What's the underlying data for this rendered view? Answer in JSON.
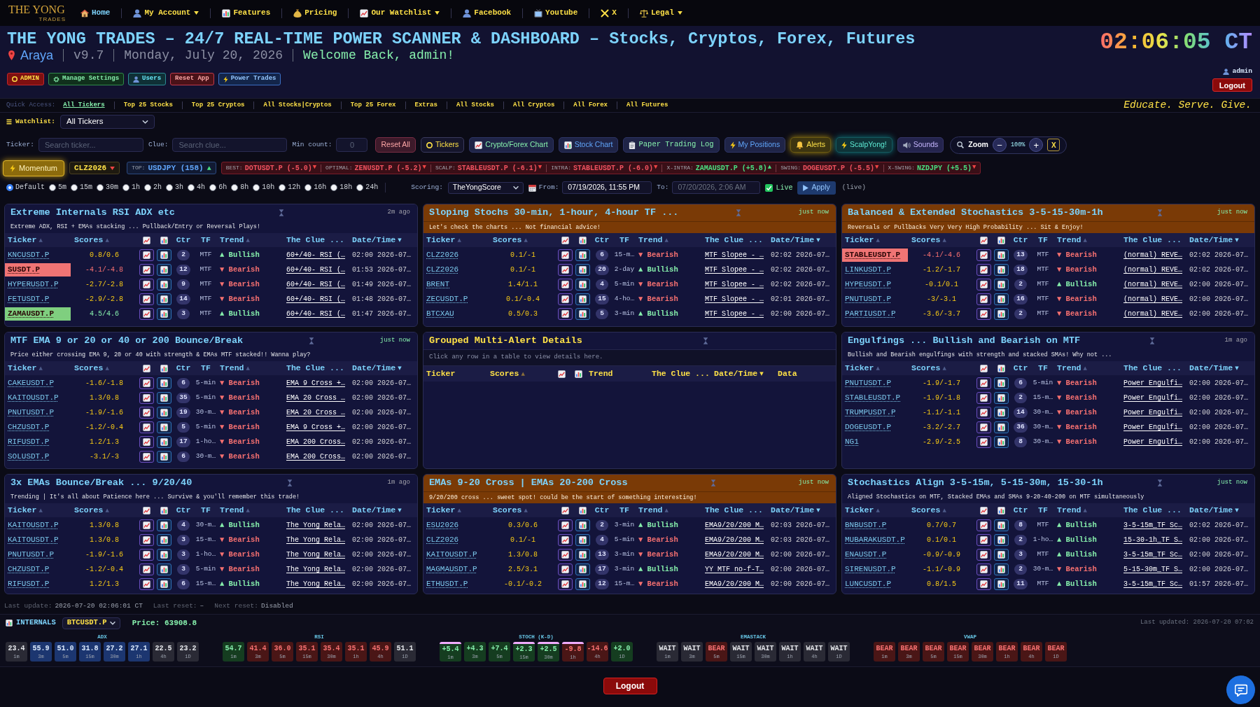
{
  "nav": {
    "logo": {
      "top": "THE YONG",
      "bottom": "TRADES"
    },
    "items": [
      {
        "kind": "home",
        "label": "Home",
        "selected": true,
        "dropdown": false
      },
      {
        "kind": "account",
        "label": "My Account",
        "selected": false,
        "dropdown": true
      },
      {
        "kind": "features",
        "label": "Features",
        "selected": false,
        "dropdown": false
      },
      {
        "kind": "pricing",
        "label": "Pricing",
        "selected": false,
        "dropdown": false
      },
      {
        "kind": "watchlist",
        "label": "Our Watchlist",
        "selected": false,
        "dropdown": true
      },
      {
        "kind": "facebook",
        "label": "Facebook",
        "selected": false,
        "dropdown": false
      },
      {
        "kind": "youtube",
        "label": "Youtube",
        "selected": false,
        "dropdown": false
      },
      {
        "kind": "x",
        "label": "X",
        "selected": false,
        "dropdown": false
      },
      {
        "kind": "legal",
        "label": "Legal",
        "selected": false,
        "dropdown": true
      }
    ]
  },
  "header": {
    "title": "THE YONG TRADES – 24/7 REAL-TIME POWER SCANNER & DASHBOARD – Stocks, Cryptos, Forex, Futures",
    "location": "Araya",
    "version": "v9.7",
    "date": "Monday, July 20, 2026",
    "welcome": "Welcome Back, admin!",
    "buttons": [
      {
        "kind": "admin",
        "label": "ADMIN"
      },
      {
        "kind": "settings",
        "label": "Manage Settings"
      },
      {
        "kind": "users",
        "label": "Users"
      },
      {
        "kind": "reset",
        "label": "Reset App"
      },
      {
        "kind": "power",
        "label": "Power Trades"
      }
    ],
    "clock": "02:06:05 CT",
    "user": "admin",
    "logout": "Logout"
  },
  "quick_access": {
    "label": "Quick Access:",
    "items": [
      {
        "label": "All Tickers",
        "selected": true
      },
      {
        "label": "Top 25 Stocks",
        "selected": false
      },
      {
        "label": "Top 25 Cryptos",
        "selected": false
      },
      {
        "label": "All Stocks|Cryptos",
        "selected": false
      },
      {
        "label": "Top 25 Forex",
        "selected": false
      },
      {
        "label": "Extras",
        "selected": false
      },
      {
        "label": "All Stocks",
        "selected": false
      },
      {
        "label": "All Cryptos",
        "selected": false
      },
      {
        "label": "All Forex",
        "selected": false
      },
      {
        "label": "All Futures",
        "selected": false
      }
    ],
    "motto": "Educate. Serve. Give."
  },
  "watchlist": {
    "label": "Watchlist:",
    "value": "All Tickers"
  },
  "filters": {
    "fields": [
      {
        "label": "Ticker:",
        "placeholder": "Search ticker..."
      },
      {
        "label": "Clue:",
        "placeholder": "Search clue..."
      },
      {
        "label": "Min count:",
        "placeholder": "0"
      }
    ],
    "buttons": [
      {
        "kind": "reset",
        "label": "Reset All"
      },
      {
        "kind": "tickers",
        "label": "Tickers"
      },
      {
        "kind": "crypto_chart",
        "label": "Crypto/Forex Chart"
      },
      {
        "kind": "stock_chart",
        "label": "Stock Chart"
      },
      {
        "kind": "paper_log",
        "label": "Paper Trading Log"
      },
      {
        "kind": "positions",
        "label": "My Positions"
      },
      {
        "kind": "alerts",
        "label": "Alerts"
      },
      {
        "kind": "scalp",
        "label": "ScalpYong!"
      },
      {
        "kind": "sounds",
        "label": "Sounds"
      }
    ],
    "zoom": {
      "label": "Zoom",
      "minus": "−",
      "value": "100%",
      "plus": "+",
      "close": "X"
    }
  },
  "momentum": {
    "mode": "Momentum",
    "symbol": "CLZ2026",
    "top": {
      "label": "TOP:",
      "value": "USDJPY (158)",
      "arrow": "▲",
      "up": true
    },
    "signals": [
      {
        "label": "BEST:",
        "value": "DOTUSDT.P (-5.0)",
        "arrow": "▼",
        "positive": false,
        "up": false
      },
      {
        "label": "OPTIMAL:",
        "value": "ZENUSDT.P (-5.2)",
        "arrow": "▼",
        "positive": false,
        "up": false
      },
      {
        "label": "SCALP:",
        "value": "STABLEUSDT.P (-6.1)",
        "arrow": "▼",
        "positive": false,
        "up": false
      },
      {
        "label": "INTRA:",
        "value": "STABLEUSDT.P (-6.0)",
        "arrow": "▼",
        "positive": false,
        "up": false
      },
      {
        "label": "X-INTRA:",
        "value": "ZAMAUSDT.P (+5.8)",
        "arrow": "▲",
        "positive": true,
        "up": true
      },
      {
        "label": "SWING:",
        "value": "DOGEUSDT.P (-5.5)",
        "arrow": "▼",
        "positive": false,
        "up": false
      },
      {
        "label": "X-SWING:",
        "value": "NZDJPY (+5.5)",
        "arrow": "▼",
        "positive": true,
        "up": false
      }
    ]
  },
  "timeframes": {
    "options": [
      {
        "label": "Default",
        "selected": true
      },
      {
        "label": "5m",
        "selected": false
      },
      {
        "label": "15m",
        "selected": false
      },
      {
        "label": "30m",
        "selected": false
      },
      {
        "label": "1h",
        "selected": false
      },
      {
        "label": "2h",
        "selected": false
      },
      {
        "label": "3h",
        "selected": false
      },
      {
        "label": "4h",
        "selected": false
      },
      {
        "label": "6h",
        "selected": false
      },
      {
        "label": "8h",
        "selected": false
      },
      {
        "label": "10h",
        "selected": false
      },
      {
        "label": "12h",
        "selected": false
      },
      {
        "label": "16h",
        "selected": false
      },
      {
        "label": "18h",
        "selected": false
      },
      {
        "label": "24h",
        "selected": false
      }
    ],
    "scoring": {
      "label": "Scoring:",
      "value": "TheYongScore"
    },
    "from": {
      "label": "From:",
      "value": "07/19/2026, 11:55 PM",
      "disabled": false
    },
    "to": {
      "label": "To:",
      "value": "07/20/2026, 2:06 AM",
      "disabled": true
    },
    "live": {
      "label": "Live",
      "checked": true
    },
    "apply": "Apply",
    "note": "(live)"
  },
  "panels": [
    {
      "kind": "alerts",
      "title": "Extreme Internals RSI ADX etc",
      "age": "2m ago",
      "fresh": false,
      "highlighted": false,
      "subtitle": "Extreme ADX, RSI + EMAs stacking ... Pullback/Entry or Reversal Plays!",
      "columns": [
        {
          "kind": "text",
          "label": "Ticker",
          "sort": "▲",
          "sorted": false
        },
        {
          "kind": "text",
          "label": "Scores",
          "sort": "▲",
          "sorted": false
        },
        {
          "kind": "line_chart"
        },
        {
          "kind": "bar_chart"
        },
        {
          "kind": "text",
          "label": "Ctr"
        },
        {
          "kind": "text",
          "label": "TF"
        },
        {
          "kind": "text",
          "label": "Trend",
          "sort": "▲",
          "sorted": false
        },
        {
          "kind": "text",
          "label": "The Clue ..."
        },
        {
          "kind": "text",
          "label": "Date/Time",
          "sort": "▼",
          "sorted": true
        }
      ],
      "rows": [
        {
          "ticker": "KNCUSDT.P",
          "highlighted": false,
          "scores": "0.8/0.6",
          "ctr": "2",
          "tf": "MTF",
          "trend": "▲ Bullish",
          "up": true,
          "clue": "60+/40- RSI (…",
          "time": "02:00 2026-07…"
        },
        {
          "ticker": "SUSDT.P",
          "highlighted": true,
          "scores": "-4.1/-4.8",
          "ctr": "12",
          "tf": "MTF",
          "trend": "▼ Bearish",
          "up": false,
          "clue": "60+/40- RSI (…",
          "time": "01:53 2026-07…"
        },
        {
          "ticker": "HYPERUSDT.P",
          "highlighted": false,
          "scores": "-2.7/-2.8",
          "ctr": "9",
          "tf": "MTF",
          "trend": "▼ Bearish",
          "up": false,
          "clue": "60+/40- RSI (…",
          "time": "01:49 2026-07…"
        },
        {
          "ticker": "FETUSDT.P",
          "highlighted": false,
          "scores": "-2.9/-2.8",
          "ctr": "14",
          "tf": "MTF",
          "trend": "▼ Bearish",
          "up": false,
          "clue": "60+/40- RSI (…",
          "time": "01:48 2026-07…"
        },
        {
          "ticker": "ZAMAUSDT.P",
          "highlighted": true,
          "scores": "4.5/4.6",
          "ctr": "3",
          "tf": "MTF",
          "trend": "▲ Bullish",
          "up": true,
          "clue": "60+/40- RSI (…",
          "time": "01:47 2026-07…"
        }
      ]
    },
    {
      "kind": "alerts",
      "title": "Sloping Stochs 30-min, 1-hour, 4-hour TF ...",
      "age": "just now",
      "fresh": true,
      "highlighted": true,
      "subtitle": "Let's check the charts ... Not financial advice!",
      "columns": [
        {
          "kind": "text",
          "label": "Ticker",
          "sort": "▲",
          "sorted": false
        },
        {
          "kind": "text",
          "label": "Scores",
          "sort": "▲",
          "sorted": false
        },
        {
          "kind": "line_chart"
        },
        {
          "kind": "bar_chart"
        },
        {
          "kind": "text",
          "label": "Ctr"
        },
        {
          "kind": "text",
          "label": "TF"
        },
        {
          "kind": "text",
          "label": "Trend",
          "sort": "▲",
          "sorted": false
        },
        {
          "kind": "text",
          "label": "The Clue ..."
        },
        {
          "kind": "text",
          "label": "Date/Time",
          "sort": "▼",
          "sorted": true
        }
      ],
      "rows": [
        {
          "ticker": "CLZ2026",
          "highlighted": false,
          "scores": "0.1/-1",
          "ctr": "6",
          "tf": "15-m…",
          "trend": "▼ Bearish",
          "up": false,
          "clue": "MTF Slopee - …",
          "time": "02:02 2026-07…"
        },
        {
          "ticker": "CLZ2026",
          "highlighted": false,
          "scores": "0.1/-1",
          "ctr": "20",
          "tf": "2-day",
          "trend": "▲ Bullish",
          "up": true,
          "clue": "MTF Slopee - …",
          "time": "02:02 2026-07…"
        },
        {
          "ticker": "BRENT",
          "highlighted": false,
          "scores": "1.4/1.1",
          "ctr": "4",
          "tf": "5-min",
          "trend": "▼ Bearish",
          "up": false,
          "clue": "MTF Slopee - …",
          "time": "02:02 2026-07…"
        },
        {
          "ticker": "ZECUSDT.P",
          "highlighted": false,
          "scores": "0.1/-0.4",
          "ctr": "15",
          "tf": "4-ho…",
          "trend": "▼ Bearish",
          "up": false,
          "clue": "MTF Slopee - …",
          "time": "02:01 2026-07…"
        },
        {
          "ticker": "BTCXAU",
          "highlighted": false,
          "scores": "0.5/0.3",
          "ctr": "5",
          "tf": "3-min",
          "trend": "▲ Bullish",
          "up": true,
          "clue": "MTF Slopee - …",
          "time": "02:00 2026-07…"
        }
      ]
    },
    {
      "kind": "alerts",
      "title": "Balanced & Extended Stochastics 3-5-15-30m-1h",
      "age": "just now",
      "fresh": true,
      "highlighted": true,
      "subtitle": "Reversals or Pullbacks Very Very High Probability ... Sit & Enjoy!",
      "columns": [
        {
          "kind": "text",
          "label": "Ticker",
          "sort": "▲",
          "sorted": false
        },
        {
          "kind": "text",
          "label": "Scores",
          "sort": "▲",
          "sorted": false
        },
        {
          "kind": "line_chart"
        },
        {
          "kind": "bar_chart"
        },
        {
          "kind": "text",
          "label": "Ctr"
        },
        {
          "kind": "text",
          "label": "TF"
        },
        {
          "kind": "text",
          "label": "Trend",
          "sort": "▲",
          "sorted": false
        },
        {
          "kind": "text",
          "label": "The Clue ..."
        },
        {
          "kind": "text",
          "label": "Date/Time",
          "sort": "▼",
          "sorted": true
        }
      ],
      "rows": [
        {
          "ticker": "STABLEUSDT.P",
          "highlighted": true,
          "scores": "-4.1/-4.6",
          "ctr": "13",
          "tf": "MTF",
          "trend": "▼ Bearish",
          "up": false,
          "clue": "(normal) REVE…",
          "time": "02:02 2026-07…"
        },
        {
          "ticker": "LINKUSDT.P",
          "highlighted": false,
          "scores": "-1.2/-1.7",
          "ctr": "18",
          "tf": "MTF",
          "trend": "▼ Bearish",
          "up": false,
          "clue": "(normal) REVE…",
          "time": "02:02 2026-07…"
        },
        {
          "ticker": "HYPEUSDT.P",
          "highlighted": false,
          "scores": "-0.1/0.1",
          "ctr": "2",
          "tf": "MTF",
          "trend": "▲ Bullish",
          "up": true,
          "clue": "(normal) REVE…",
          "time": "02:00 2026-07…"
        },
        {
          "ticker": "PNUTUSDT.P",
          "highlighted": false,
          "scores": "-3/-3.1",
          "ctr": "16",
          "tf": "MTF",
          "trend": "▼ Bearish",
          "up": false,
          "clue": "(normal) REVE…",
          "time": "02:00 2026-07…"
        },
        {
          "ticker": "PARTIUSDT.P",
          "highlighted": false,
          "scores": "-3.6/-3.7",
          "ctr": "2",
          "tf": "MTF",
          "trend": "▼ Bearish",
          "up": false,
          "clue": "(normal) REVE…",
          "time": "02:00 2026-07…"
        }
      ]
    },
    {
      "kind": "alerts",
      "title": "MTF EMA 9 or 20 or 40 or 200 Bounce/Break",
      "age": "just now",
      "fresh": true,
      "highlighted": false,
      "subtitle": "Price either crossing EMA 9, 20 or 40 with strength & EMAs MTF stacked!! Wanna play?",
      "columns": [
        {
          "kind": "text",
          "label": "Ticker",
          "sort": "▲",
          "sorted": false
        },
        {
          "kind": "text",
          "label": "Scores",
          "sort": "▲",
          "sorted": false
        },
        {
          "kind": "line_chart"
        },
        {
          "kind": "bar_chart"
        },
        {
          "kind": "text",
          "label": "Ctr"
        },
        {
          "kind": "text",
          "label": "TF"
        },
        {
          "kind": "text",
          "label": "Trend",
          "sort": "▲",
          "sorted": false
        },
        {
          "kind": "text",
          "label": "The Clue ..."
        },
        {
          "kind": "text",
          "label": "Date/Time",
          "sort": "▼",
          "sorted": true
        }
      ],
      "rows": [
        {
          "ticker": "CAKEUSDT.P",
          "highlighted": false,
          "scores": "-1.6/-1.8",
          "ctr": "6",
          "tf": "5-min",
          "trend": "▼ Bearish",
          "up": false,
          "clue": "EMA 9 Cross +…",
          "time": "02:00 2026-07…"
        },
        {
          "ticker": "KAITOUSDT.P",
          "highlighted": false,
          "scores": "1.3/0.8",
          "ctr": "35",
          "tf": "5-min",
          "trend": "▼ Bearish",
          "up": false,
          "clue": "EMA 20 Cross …",
          "time": "02:00 2026-07…"
        },
        {
          "ticker": "PNUTUSDT.P",
          "highlighted": false,
          "scores": "-1.9/-1.6",
          "ctr": "19",
          "tf": "30-m…",
          "trend": "▼ Bearish",
          "up": false,
          "clue": "EMA 20 Cross …",
          "time": "02:00 2026-07…"
        },
        {
          "ticker": "CHZUSDT.P",
          "highlighted": false,
          "scores": "-1.2/-0.4",
          "ctr": "5",
          "tf": "5-min",
          "trend": "▼ Bearish",
          "up": false,
          "clue": "EMA 9 Cross +…",
          "time": "02:00 2026-07…"
        },
        {
          "ticker": "RIFUSDT.P",
          "highlighted": false,
          "scores": "1.2/1.3",
          "ctr": "17",
          "tf": "1-ho…",
          "trend": "▼ Bearish",
          "up": false,
          "clue": "EMA 200 Cross…",
          "time": "02:00 2026-07…"
        },
        {
          "ticker": "SOLUSDT.P",
          "highlighted": false,
          "scores": "-3.1/-3",
          "ctr": "6",
          "tf": "30-m…",
          "trend": "▼ Bearish",
          "up": false,
          "clue": "EMA 200 Cross…",
          "time": "02:00 2026-07…"
        }
      ]
    },
    {
      "kind": "details",
      "title": "Grouped Multi-Alert Details",
      "highlighted": false,
      "subtitle": "Click any row in a table to view details here.",
      "columns": [
        {
          "kind": "text",
          "label": "Ticker"
        },
        {
          "kind": "text",
          "label": "Scores",
          "sort": "▲",
          "sorted": false
        },
        {
          "kind": "line_chart"
        },
        {
          "kind": "bar_chart"
        },
        {
          "kind": "text",
          "label": "Trend"
        },
        {
          "kind": "text",
          "label": "The Clue ..."
        },
        {
          "kind": "text",
          "label": "Date/Time",
          "sort": "▼",
          "sorted": true
        },
        {
          "kind": "text",
          "label": "Data"
        }
      ]
    },
    {
      "kind": "alerts",
      "title": "Engulfings ... Bullish and Bearish on MTF",
      "age": "1m ago",
      "fresh": false,
      "highlighted": false,
      "subtitle": "Bullish and Bearish engulfings with strength and stacked SMAs! Why not ...",
      "columns": [
        {
          "kind": "text",
          "label": "Ticker",
          "sort": "▲",
          "sorted": false
        },
        {
          "kind": "text",
          "label": "Scores",
          "sort": "▲",
          "sorted": false
        },
        {
          "kind": "line_chart"
        },
        {
          "kind": "bar_chart"
        },
        {
          "kind": "text",
          "label": "Ctr"
        },
        {
          "kind": "text",
          "label": "TF"
        },
        {
          "kind": "text",
          "label": "Trend",
          "sort": "▲",
          "sorted": false
        },
        {
          "kind": "text",
          "label": "The Clue ..."
        },
        {
          "kind": "text",
          "label": "Date/Time",
          "sort": "▼",
          "sorted": true
        }
      ],
      "rows": [
        {
          "ticker": "PNUTUSDT.P",
          "highlighted": false,
          "scores": "-1.9/-1.7",
          "ctr": "6",
          "tf": "5-min",
          "trend": "▼ Bearish",
          "up": false,
          "clue": "Power Engulfi…",
          "time": "02:00 2026-07…"
        },
        {
          "ticker": "STABLEUSDT.P",
          "highlighted": false,
          "scores": "-1.9/-1.8",
          "ctr": "2",
          "tf": "15-m…",
          "trend": "▼ Bearish",
          "up": false,
          "clue": "Power Engulfi…",
          "time": "02:00 2026-07…"
        },
        {
          "ticker": "TRUMPUSDT.P",
          "highlighted": false,
          "scores": "-1.1/-1.1",
          "ctr": "14",
          "tf": "30-m…",
          "trend": "▼ Bearish",
          "up": false,
          "clue": "Power Engulfi…",
          "time": "02:00 2026-07…"
        },
        {
          "ticker": "DOGEUSDT.P",
          "highlighted": false,
          "scores": "-3.2/-2.7",
          "ctr": "36",
          "tf": "30-m…",
          "trend": "▼ Bearish",
          "up": false,
          "clue": "Power Engulfi…",
          "time": "02:00 2026-07…"
        },
        {
          "ticker": "NG1",
          "highlighted": false,
          "scores": "-2.9/-2.5",
          "ctr": "8",
          "tf": "30-m…",
          "trend": "▼ Bearish",
          "up": false,
          "clue": "Power Engulfi…",
          "time": "02:00 2026-07…"
        }
      ]
    },
    {
      "kind": "alerts",
      "title": "3x EMAs Bounce/Break ... 9/20/40",
      "age": "1m ago",
      "fresh": false,
      "highlighted": false,
      "subtitle": "Trending | It's all about Patience here ... Survive & you'll remember this trade!",
      "columns": [
        {
          "kind": "text",
          "label": "Ticker",
          "sort": "▲",
          "sorted": false
        },
        {
          "kind": "text",
          "label": "Scores",
          "sort": "▲",
          "sorted": false
        },
        {
          "kind": "line_chart"
        },
        {
          "kind": "bar_chart"
        },
        {
          "kind": "text",
          "label": "Ctr"
        },
        {
          "kind": "text",
          "label": "TF"
        },
        {
          "kind": "text",
          "label": "Trend",
          "sort": "▲",
          "sorted": false
        },
        {
          "kind": "text",
          "label": "The Clue ..."
        },
        {
          "kind": "text",
          "label": "Date/Time",
          "sort": "▼",
          "sorted": true
        }
      ],
      "rows": [
        {
          "ticker": "KAITOUSDT.P",
          "highlighted": false,
          "scores": "1.3/0.8",
          "ctr": "4",
          "tf": "30-m…",
          "trend": "▲ Bullish",
          "up": true,
          "clue": "The Yong Rela…",
          "time": "02:00 2026-07…"
        },
        {
          "ticker": "KAITOUSDT.P",
          "highlighted": false,
          "scores": "1.3/0.8",
          "ctr": "3",
          "tf": "15-m…",
          "trend": "▼ Bearish",
          "up": false,
          "clue": "The Yong Rela…",
          "time": "02:00 2026-07…"
        },
        {
          "ticker": "PNUTUSDT.P",
          "highlighted": false,
          "scores": "-1.9/-1.6",
          "ctr": "3",
          "tf": "1-ho…",
          "trend": "▼ Bearish",
          "up": false,
          "clue": "The Yong Rela…",
          "time": "02:00 2026-07…"
        },
        {
          "ticker": "CHZUSDT.P",
          "highlighted": false,
          "scores": "-1.2/-0.4",
          "ctr": "3",
          "tf": "5-min",
          "trend": "▼ Bearish",
          "up": false,
          "clue": "The Yong Rela…",
          "time": "02:00 2026-07…"
        },
        {
          "ticker": "RIFUSDT.P",
          "highlighted": false,
          "scores": "1.2/1.3",
          "ctr": "6",
          "tf": "15-m…",
          "trend": "▲ Bullish",
          "up": true,
          "clue": "The Yong Rela…",
          "time": "02:00 2026-07…"
        }
      ]
    },
    {
      "kind": "alerts",
      "title": "EMAs 9-20 Cross | EMAs 20-200 Cross",
      "age": "just now",
      "fresh": true,
      "highlighted": true,
      "subtitle": "9/20/200 cross ... sweet spot! could be the start of something interesting!",
      "columns": [
        {
          "kind": "text",
          "label": "Ticker",
          "sort": "▲",
          "sorted": false
        },
        {
          "kind": "text",
          "label": "Scores",
          "sort": "▲",
          "sorted": false
        },
        {
          "kind": "line_chart"
        },
        {
          "kind": "bar_chart"
        },
        {
          "kind": "text",
          "label": "Ctr"
        },
        {
          "kind": "text",
          "label": "TF"
        },
        {
          "kind": "text",
          "label": "Trend",
          "sort": "▲",
          "sorted": false
        },
        {
          "kind": "text",
          "label": "The Clue ..."
        },
        {
          "kind": "text",
          "label": "Date/Time",
          "sort": "▼",
          "sorted": true
        }
      ],
      "rows": [
        {
          "ticker": "ESU2026",
          "highlighted": false,
          "scores": "0.3/0.6",
          "ctr": "2",
          "tf": "3-min",
          "trend": "▲ Bullish",
          "up": true,
          "clue": "EMA9/20/200 M…",
          "time": "02:03 2026-07…"
        },
        {
          "ticker": "CLZ2026",
          "highlighted": false,
          "scores": "0.1/-1",
          "ctr": "4",
          "tf": "5-min",
          "trend": "▼ Bearish",
          "up": false,
          "clue": "EMA9/20/200 M…",
          "time": "02:03 2026-07…"
        },
        {
          "ticker": "KAITOUSDT.P",
          "highlighted": false,
          "scores": "1.3/0.8",
          "ctr": "13",
          "tf": "3-min",
          "trend": "▼ Bearish",
          "up": false,
          "clue": "EMA9/20/200 M…",
          "time": "02:00 2026-07…"
        },
        {
          "ticker": "MAGMAUSDT.P",
          "highlighted": false,
          "scores": "2.5/3.1",
          "ctr": "17",
          "tf": "3-min",
          "trend": "▲ Bullish",
          "up": true,
          "clue": "YY MTF no-f-T…",
          "time": "02:00 2026-07…"
        },
        {
          "ticker": "ETHUSDT.P",
          "highlighted": false,
          "scores": "-0.1/-0.2",
          "ctr": "12",
          "tf": "15-m…",
          "trend": "▼ Bearish",
          "up": false,
          "clue": "EMA9/20/200 M…",
          "time": "02:00 2026-07…"
        }
      ]
    },
    {
      "kind": "alerts",
      "title": "Stochastics Align 3-5-15m, 5-15-30m, 15-30-1h",
      "age": "just now",
      "fresh": true,
      "highlighted": false,
      "subtitle": "Aligned Stochastics on MTF, Stacked EMAs and SMAs 9-20-40-200 on MTF simultaneously",
      "columns": [
        {
          "kind": "text",
          "label": "Ticker",
          "sort": "▲",
          "sorted": false
        },
        {
          "kind": "text",
          "label": "Scores",
          "sort": "▲",
          "sorted": false
        },
        {
          "kind": "line_chart"
        },
        {
          "kind": "bar_chart"
        },
        {
          "kind": "text",
          "label": "Ctr"
        },
        {
          "kind": "text",
          "label": "TF"
        },
        {
          "kind": "text",
          "label": "Trend",
          "sort": "▲",
          "sorted": false
        },
        {
          "kind": "text",
          "label": "The Clue ..."
        },
        {
          "kind": "text",
          "label": "Date/Time",
          "sort": "▼",
          "sorted": true
        }
      ],
      "rows": [
        {
          "ticker": "BNBUSDT.P",
          "highlighted": false,
          "scores": "0.7/0.7",
          "ctr": "8",
          "tf": "MTF",
          "trend": "▲ Bullish",
          "up": true,
          "clue": "3-5-15m_TF Sc…",
          "time": "02:02 2026-07…"
        },
        {
          "ticker": "MUBARAKUSDT.P",
          "highlighted": false,
          "scores": "0.1/0.1",
          "ctr": "2",
          "tf": "1-ho…",
          "trend": "▲ Bullish",
          "up": true,
          "clue": "15-30-1h_TF S…",
          "time": "02:00 2026-07…"
        },
        {
          "ticker": "ENAUSDT.P",
          "highlighted": false,
          "scores": "-0.9/-0.9",
          "ctr": "3",
          "tf": "MTF",
          "trend": "▲ Bullish",
          "up": true,
          "clue": "3-5-15m_TF Sc…",
          "time": "02:00 2026-07…"
        },
        {
          "ticker": "SIRENUSDT.P",
          "highlighted": false,
          "scores": "-1.1/-0.9",
          "ctr": "2",
          "tf": "30-m…",
          "trend": "▼ Bearish",
          "up": false,
          "clue": "5-15-30m_TF S…",
          "time": "02:00 2026-07…"
        },
        {
          "ticker": "LUNCUSDT.P",
          "highlighted": false,
          "scores": "0.8/1.5",
          "ctr": "11",
          "tf": "MTF",
          "trend": "▲ Bullish",
          "up": true,
          "clue": "3-5-15m_TF Sc…",
          "time": "01:57 2026-07…"
        }
      ]
    }
  ],
  "status": [
    {
      "label": "Last update:",
      "value": "2026-07-20 02:06:01 CT"
    },
    {
      "label": "Last reset:",
      "value": "–"
    },
    {
      "label": "Next reset:",
      "value": "Disabled"
    }
  ],
  "internals": {
    "label": "INTERNALS",
    "symbol": "BTCUSDT.P",
    "price": "Price: 63908.8",
    "updated": "Last updated: 2026-07-20 07:02",
    "groups": [
      {
        "name": "ADX",
        "tiles": [
          {
            "value": "23.4",
            "tf": "1m",
            "kind": "neutral"
          },
          {
            "value": "55.9",
            "tf": "3m",
            "kind": "blue"
          },
          {
            "value": "51.0",
            "tf": "5m",
            "kind": "blue"
          },
          {
            "value": "31.8",
            "tf": "15m",
            "kind": "blue"
          },
          {
            "value": "27.2",
            "tf": "30m",
            "kind": "blue"
          },
          {
            "value": "27.1",
            "tf": "1h",
            "kind": "blue"
          },
          {
            "value": "22.5",
            "tf": "4h",
            "kind": "neutral"
          },
          {
            "value": "23.2",
            "tf": "1D",
            "kind": "neutral"
          }
        ]
      },
      {
        "name": "RSI",
        "tiles": [
          {
            "value": "54.7",
            "tf": "1m",
            "kind": "green"
          },
          {
            "value": "41.4",
            "tf": "3m",
            "kind": "red"
          },
          {
            "value": "36.0",
            "tf": "5m",
            "kind": "red"
          },
          {
            "value": "35.1",
            "tf": "15m",
            "kind": "red"
          },
          {
            "value": "35.4",
            "tf": "30m",
            "kind": "red"
          },
          {
            "value": "35.1",
            "tf": "1h",
            "kind": "red"
          },
          {
            "value": "45.9",
            "tf": "4h",
            "kind": "red"
          },
          {
            "value": "51.1",
            "tf": "1D",
            "kind": "neutral"
          }
        ]
      },
      {
        "name": "STOCH (K-D)",
        "tiles": [
          {
            "value": "+5.4",
            "tf": "1m",
            "kind": "green",
            "flagged": true
          },
          {
            "value": "+4.3",
            "tf": "3m",
            "kind": "green",
            "flagged": false
          },
          {
            "value": "+7.4",
            "tf": "5m",
            "kind": "green",
            "flagged": false
          },
          {
            "value": "+2.3",
            "tf": "15m",
            "kind": "green",
            "flagged": true
          },
          {
            "value": "+2.5",
            "tf": "30m",
            "kind": "green",
            "flagged": true
          },
          {
            "value": "-9.8",
            "tf": "1h",
            "kind": "red",
            "flagged": true
          },
          {
            "value": "-14.6",
            "tf": "4h",
            "kind": "red",
            "flagged": false
          },
          {
            "value": "+2.0",
            "tf": "1D",
            "kind": "green",
            "flagged": false
          }
        ]
      },
      {
        "name": "EMASTACK",
        "tiles": [
          {
            "value": "WAIT",
            "tf": "1m",
            "kind": "neutral"
          },
          {
            "value": "WAIT",
            "tf": "3m",
            "kind": "neutral"
          },
          {
            "value": "BEAR",
            "tf": "5m",
            "kind": "red"
          },
          {
            "value": "WAIT",
            "tf": "15m",
            "kind": "neutral"
          },
          {
            "value": "WAIT",
            "tf": "30m",
            "kind": "neutral"
          },
          {
            "value": "WAIT",
            "tf": "1h",
            "kind": "neutral"
          },
          {
            "value": "WAIT",
            "tf": "4h",
            "kind": "neutral"
          },
          {
            "value": "WAIT",
            "tf": "1D",
            "kind": "neutral"
          }
        ]
      },
      {
        "name": "VWAP",
        "tiles": [
          {
            "value": "BEAR",
            "tf": "1m",
            "kind": "red"
          },
          {
            "value": "BEAR",
            "tf": "3m",
            "kind": "red"
          },
          {
            "value": "BEAR",
            "tf": "5m",
            "kind": "red"
          },
          {
            "value": "BEAR",
            "tf": "15m",
            "kind": "red"
          },
          {
            "value": "BEAR",
            "tf": "30m",
            "kind": "red"
          },
          {
            "value": "BEAR",
            "tf": "1h",
            "kind": "red"
          },
          {
            "value": "BEAR",
            "tf": "4h",
            "kind": "red"
          },
          {
            "value": "BEAR",
            "tf": "1D",
            "kind": "red"
          }
        ]
      }
    ]
  },
  "logout": "Logout"
}
